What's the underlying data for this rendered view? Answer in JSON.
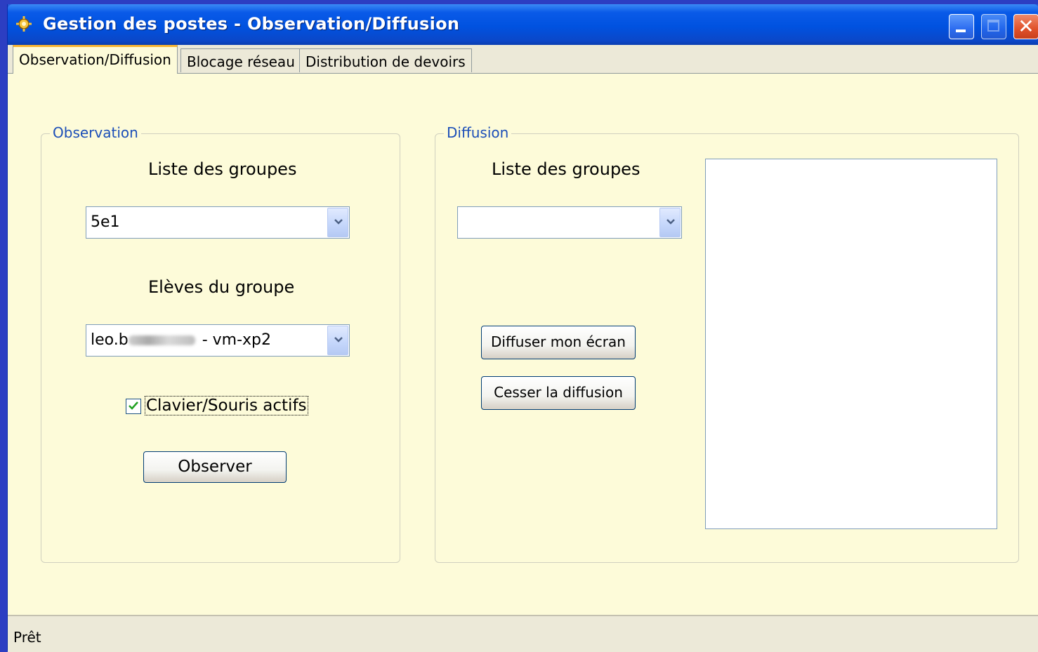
{
  "window": {
    "title": "Gestion des postes - Observation/Diffusion",
    "icon": "app-gear-icon"
  },
  "tabs": [
    {
      "label": "Observation/Diffusion",
      "active": true
    },
    {
      "label": "Blocage réseau",
      "active": false
    },
    {
      "label": "Distribution de devoirs",
      "active": false
    }
  ],
  "observation": {
    "legend": "Observation",
    "groups_label": "Liste des groupes",
    "group_value": "5e1",
    "students_label": "Elèves du groupe",
    "student_value_prefix": "leo.b",
    "student_value_suffix": "- vm-xp2",
    "keyboard_mouse_label": "Clavier/Souris actifs",
    "keyboard_mouse_checked": true,
    "observe_button": "Observer"
  },
  "diffusion": {
    "legend": "Diffusion",
    "groups_label": "Liste des groupes",
    "group_value": "",
    "broadcast_button": "Diffuser mon écran",
    "stop_button": "Cesser la diffusion"
  },
  "status": {
    "text": "Prêt"
  },
  "colors": {
    "content_bg": "#fdfbd9",
    "title_bar": "#0052e0",
    "legend_text": "#1c4fb8",
    "close_button": "#e0512a"
  }
}
